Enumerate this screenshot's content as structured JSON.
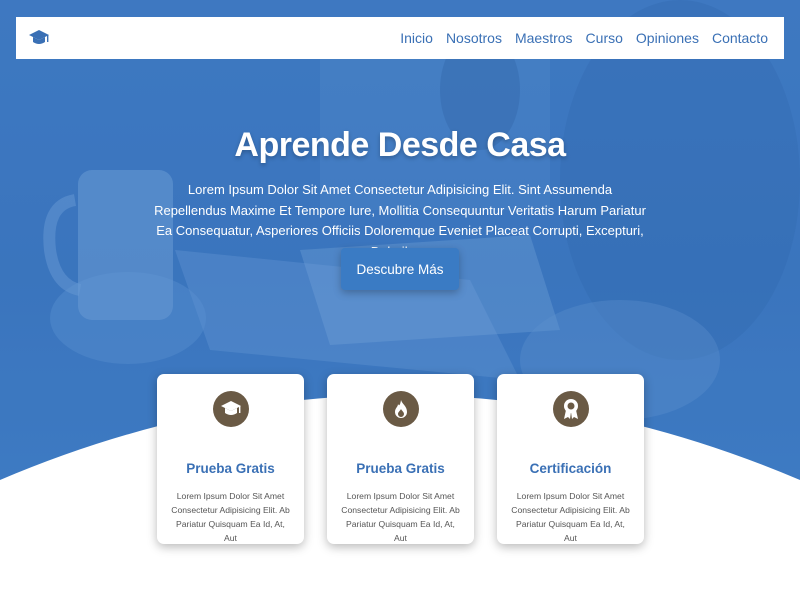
{
  "nav": {
    "logo_icon": "graduation-cap-icon",
    "links": [
      "Inicio",
      "Nosotros",
      "Maestros",
      "Curso",
      "Opiniones",
      "Contacto"
    ]
  },
  "hero": {
    "title": "Aprende Desde Casa",
    "text": "Lorem Ipsum Dolor Sit Amet Consectetur Adipisicing Elit. Sint Assumenda Repellendus Maxime Et Tempore Iure, Mollitia Consequuntur Veritatis Harum Pariatur Ea Consequatur, Asperiores Officiis Doloremque Eveniet Placeat Corrupti, Excepturi, Doloribus.",
    "button_label": "Descubre Más"
  },
  "cards": [
    {
      "icon": "graduation-cap-icon",
      "title": "Prueba Gratis",
      "text": "Lorem Ipsum Dolor Sit Amet Consectetur Adipisicing Elit. Ab Pariatur Quisquam Ea Id, At, Aut"
    },
    {
      "icon": "fire-icon",
      "title": "Prueba Gratis",
      "text": "Lorem Ipsum Dolor Sit Amet Consectetur Adipisicing Elit. Ab Pariatur Quisquam Ea Id, At, Aut"
    },
    {
      "icon": "award-icon",
      "title": "Certificación",
      "text": "Lorem Ipsum Dolor Sit Amet Consectetur Adipisicing Elit. Ab Pariatur Quisquam Ea Id, At, Aut"
    }
  ],
  "colors": {
    "primary": "#3a70b5",
    "hero_overlay": "#3f79c2",
    "icon_circle": "#6a5a45",
    "white": "#ffffff"
  }
}
